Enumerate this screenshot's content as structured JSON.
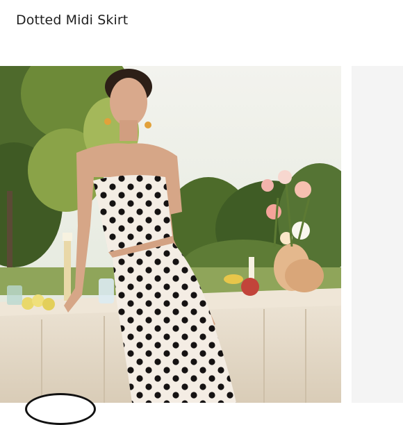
{
  "product": {
    "title": "Dotted Midi Skirt"
  },
  "gallery": {
    "active_index": 0,
    "main_image_icon": "photo-model-dotted-skirt",
    "next_image_icon": "photo-next-preview"
  },
  "colors": {
    "text": "#1f1f1f",
    "skirt_base": "#f3ece3",
    "dot": "#151212",
    "table_cloth": "#e7dccb",
    "sky": "#eef1ea",
    "foliage": "#4f6b2f"
  }
}
